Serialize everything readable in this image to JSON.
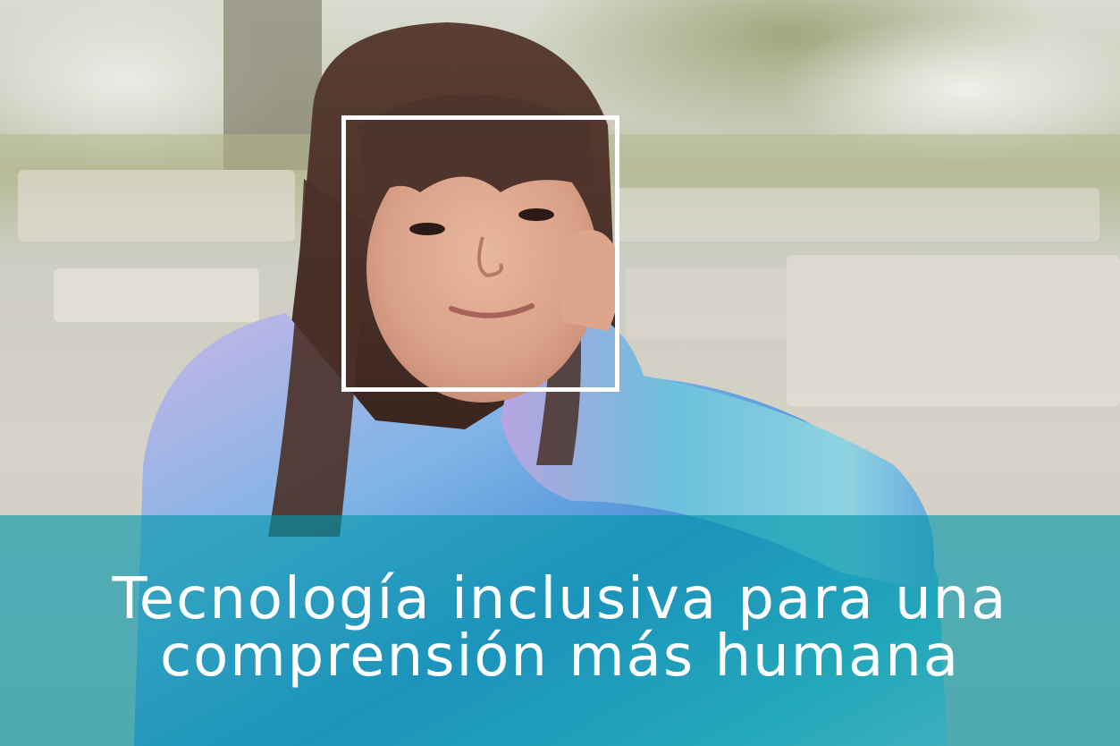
{
  "photo": {
    "subject": "smiling-person-portrait",
    "setting": "outdoor-park-benches"
  },
  "face_box": {
    "color": "#ffffff"
  },
  "caption": {
    "line1": "Tecnología inclusiva para una",
    "line2": "comprensión más humana",
    "band_color": "#0096aa",
    "text_color": "#ffffff"
  }
}
